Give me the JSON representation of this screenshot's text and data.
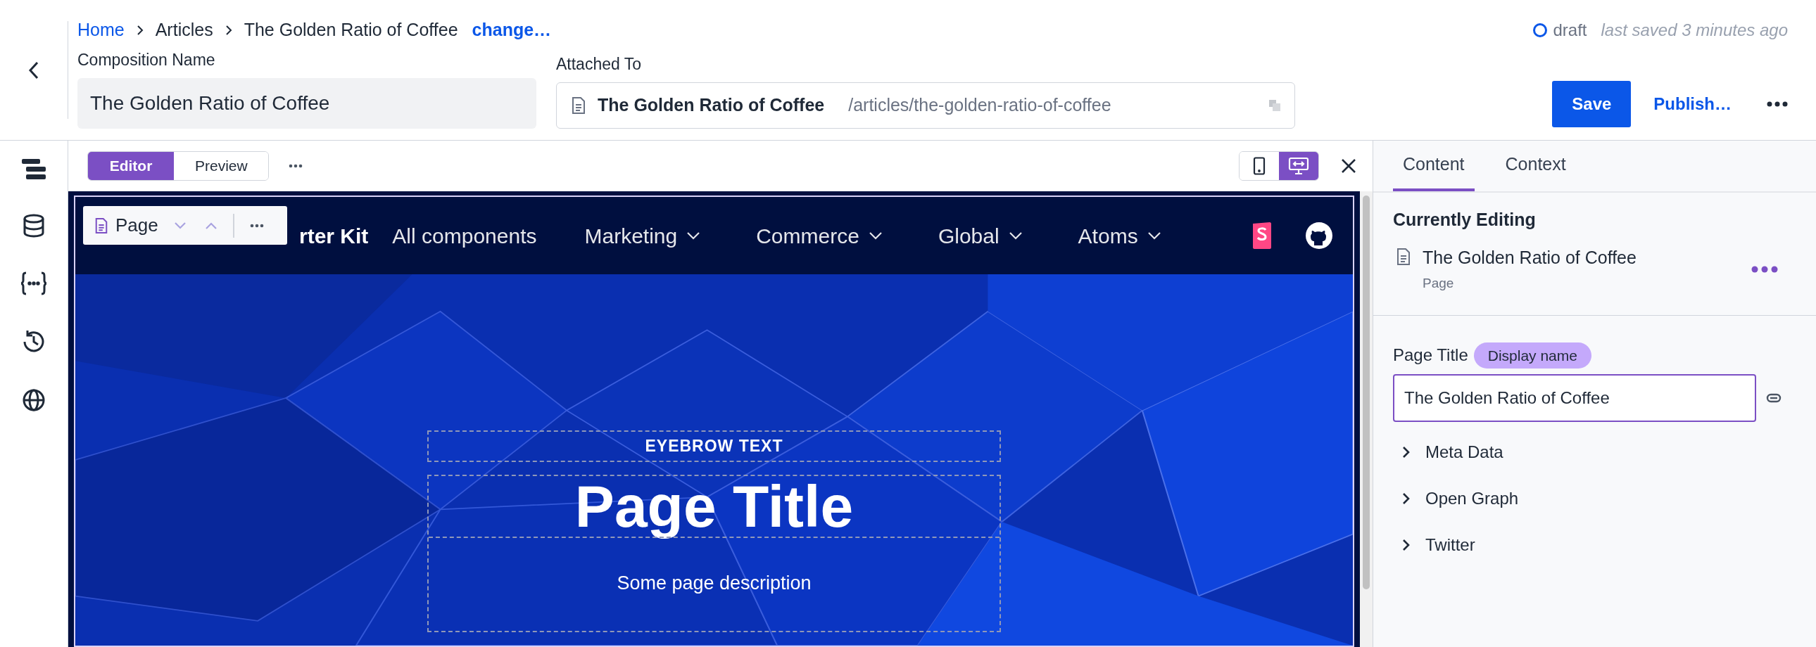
{
  "breadcrumb": {
    "items": [
      {
        "label": "Home",
        "kind": "link"
      },
      {
        "label": "Articles",
        "kind": "text"
      },
      {
        "label": "The Golden Ratio of Coffee",
        "kind": "text"
      }
    ],
    "action": "change…"
  },
  "status": {
    "label": "draft",
    "saved": "last saved 3 minutes ago"
  },
  "composition_name": {
    "label": "Composition Name",
    "value": "The Golden Ratio of Coffee"
  },
  "attached_to": {
    "label": "Attached To",
    "title": "The Golden Ratio of Coffee",
    "path": "/articles/the-golden-ratio-of-coffee"
  },
  "actions": {
    "save": "Save",
    "publish": "Publish…"
  },
  "view_modes": [
    {
      "label": "Editor",
      "selected": true
    },
    {
      "label": "Preview",
      "selected": false
    }
  ],
  "devices": [
    {
      "kind": "mobile",
      "selected": false
    },
    {
      "kind": "desktop",
      "selected": true
    }
  ],
  "floating_toolbar": {
    "label": "Page"
  },
  "canvas": {
    "brand": "rter Kit",
    "nav": [
      {
        "label": "All components",
        "dropdown": false
      },
      {
        "label": "Marketing",
        "dropdown": true
      },
      {
        "label": "Commerce",
        "dropdown": true
      },
      {
        "label": "Global",
        "dropdown": true
      },
      {
        "label": "Atoms",
        "dropdown": true
      }
    ],
    "eyebrow": "EYEBROW TEXT",
    "title": "Page Title",
    "description": "Some page description"
  },
  "panel": {
    "tabs": [
      {
        "label": "Content",
        "selected": true
      },
      {
        "label": "Context",
        "selected": false
      }
    ],
    "currently_editing": {
      "heading": "Currently Editing",
      "title": "The Golden Ratio of Coffee",
      "type": "Page"
    },
    "field": {
      "label": "Page Title",
      "badge": "Display name",
      "value": "The Golden Ratio of Coffee"
    },
    "sections": [
      {
        "label": "Meta Data",
        "expanded": false
      },
      {
        "label": "Open Graph",
        "expanded": false
      },
      {
        "label": "Twitter",
        "expanded": false
      }
    ]
  }
}
